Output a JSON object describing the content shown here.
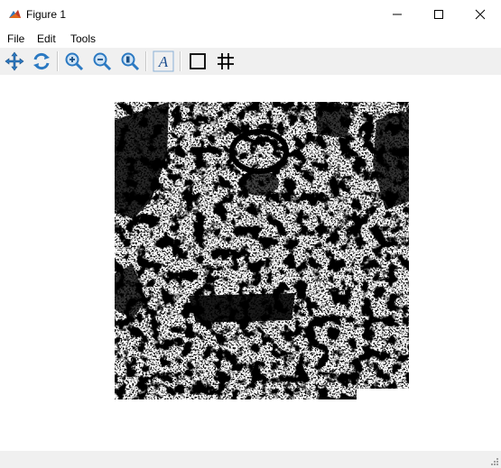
{
  "window": {
    "title": "Figure 1",
    "icon": "matlab-figure-icon"
  },
  "window_controls": [
    "minimize-icon",
    "maximize-icon",
    "close-icon"
  ],
  "menu": {
    "items": [
      "File",
      "Edit",
      "Tools"
    ]
  },
  "toolbar": {
    "buttons": [
      "pan-icon",
      "rotate-icon",
      "zoom-in-icon",
      "zoom-out-icon",
      "zoom-reset-icon",
      "insert-text-icon",
      "box-icon",
      "grid-icon"
    ]
  },
  "figure": {
    "content": "binary-thresholded-image",
    "colors": {
      "foreground": "#000000",
      "background": "#ffffff"
    }
  }
}
